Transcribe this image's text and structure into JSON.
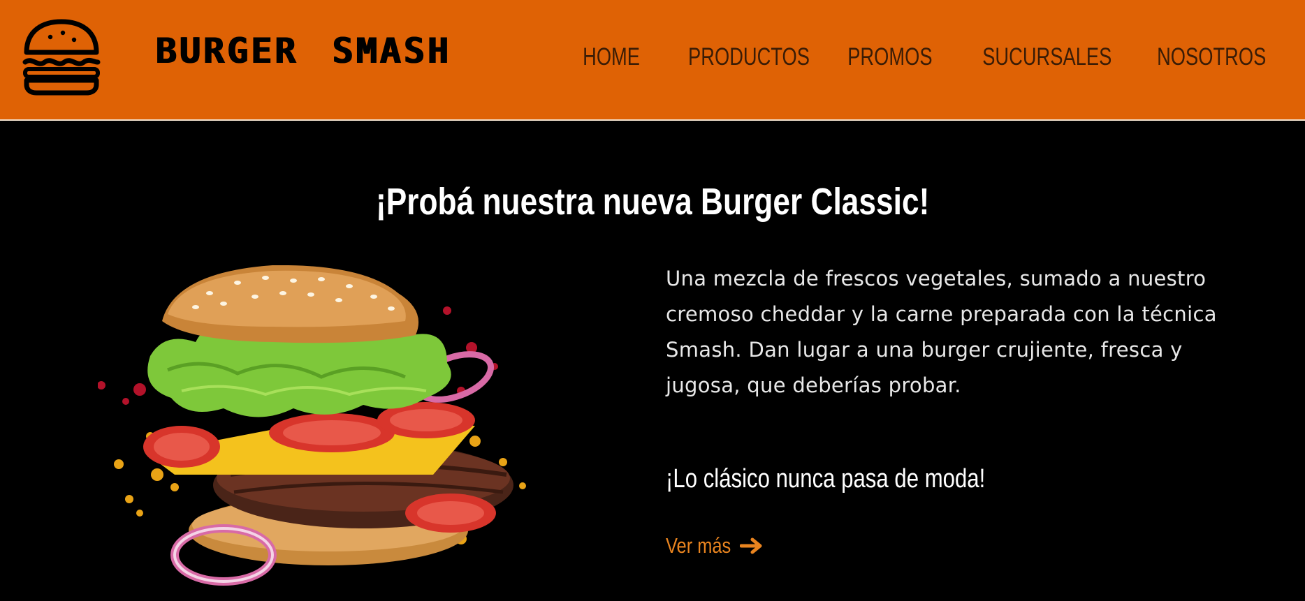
{
  "header": {
    "brand": "BURGER SMASH",
    "logo_icon": "burger-icon",
    "nav": [
      {
        "label": "HOME"
      },
      {
        "label": "PRODUCTOS"
      },
      {
        "label": "PROMOS"
      },
      {
        "label": "SUCURSALES"
      },
      {
        "label": "NOSOTROS"
      }
    ]
  },
  "hero": {
    "title": "¡Probá nuestra nueva Burger Classic!",
    "description": "Una mezcla de frescos vegetales, sumado a nuestro cremoso cheddar y la carne preparada con la técnica Smash. Dan lugar a una burger crujiente, fresca y jugosa, que deberías probar.",
    "tagline": "¡Lo clásico nunca pasa de moda!",
    "cta_label": "Ver más",
    "cta_icon": "arrow-right-icon"
  },
  "colors": {
    "header_bg": "#df6205",
    "page_bg": "#000000",
    "accent": "#e9841f"
  }
}
